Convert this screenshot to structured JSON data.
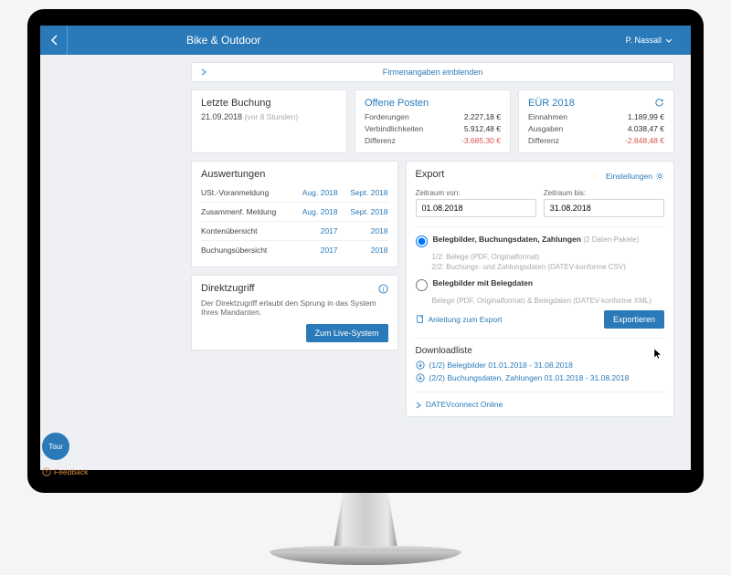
{
  "header": {
    "title": "Bike & Outdoor",
    "user": "P. Nassall"
  },
  "expand_label": "Firmenangaben einblenden",
  "last_booking": {
    "title": "Letzte Buchung",
    "date": "21.09.2018",
    "ago": "(vor 8 Stunden)"
  },
  "open_items": {
    "title": "Offene Posten",
    "rows": [
      {
        "label": "Forderungen",
        "value": "2.227,18 €"
      },
      {
        "label": "Verbindlichkeiten",
        "value": "5.912,48 €"
      },
      {
        "label": "Differenz",
        "value": "-3.685,30 €",
        "neg": true
      }
    ]
  },
  "eur": {
    "title": "EÜR 2018",
    "rows": [
      {
        "label": "Einnahmen",
        "value": "1.189,99 €"
      },
      {
        "label": "Ausgaben",
        "value": "4.038,47 €"
      },
      {
        "label": "Differenz",
        "value": "-2.848,48 €",
        "neg": true
      }
    ]
  },
  "reports": {
    "title": "Auswertungen",
    "rows": [
      {
        "label": "USt.-Voranmeldung",
        "a": "Aug. 2018",
        "b": "Sept. 2018"
      },
      {
        "label": "Zusammenf. Meldung",
        "a": "Aug. 2018",
        "b": "Sept. 2018"
      },
      {
        "label": "Kontenübersicht",
        "a": "2017",
        "b": "2018"
      },
      {
        "label": "Buchungsübersicht",
        "a": "2017",
        "b": "2018"
      }
    ]
  },
  "direct": {
    "title": "Direktzugriff",
    "text": "Der Direktzugriff erlaubt den Sprung in das System Ihres Mandanten.",
    "button": "Zum Live-System"
  },
  "export": {
    "title": "Export",
    "settings": "Einstellungen",
    "from_label": "Zeitraum von:",
    "to_label": "Zeitraum bis:",
    "from_value": "01.08.2018",
    "to_value": "31.08.2018",
    "opt1": {
      "title": "Belegbilder, Buchungsdaten, Zahlungen",
      "suffix": "(2 Daten-Pakete)",
      "l1": "1/2: Belege (PDF, Originalformat)",
      "l2": "2/2: Buchungs- und Zahlungsdaten (DATEV-konforme CSV)"
    },
    "opt2": {
      "title": "Belegbilder mit Belegdaten",
      "l1": "Belege (PDF, Originalformat) & Belegdaten (DATEV-konforme XML)"
    },
    "guide": "Anleitung zum Export",
    "button": "Exportieren"
  },
  "downloads": {
    "title": "Downloadliste",
    "items": [
      "(1/2) Belegbilder 01.01.2018 - 31.08.2018",
      "(2/2) Buchungsdaten, Zahlungen 01.01.2018 - 31.08.2018"
    ],
    "datev": "DATEVconnect Online"
  },
  "tour": "Tour",
  "feedback": "Feedback"
}
